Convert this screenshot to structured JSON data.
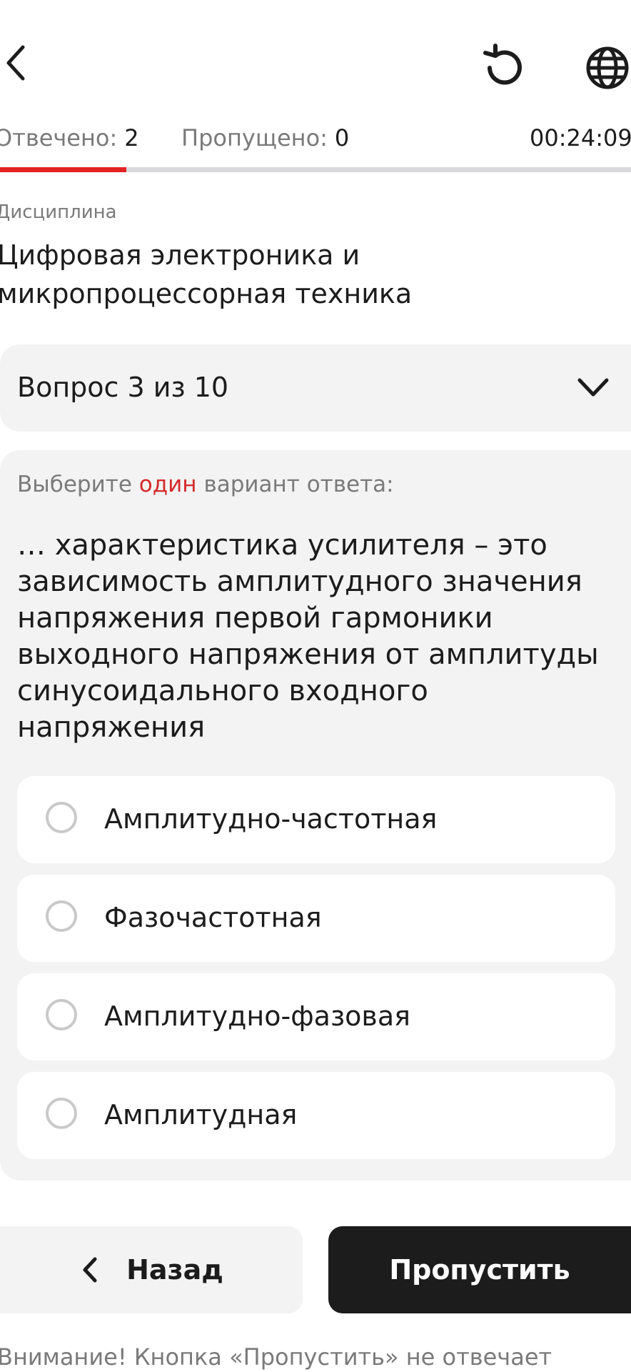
{
  "header": {
    "icons": {
      "back": "chevron-left-icon",
      "reset": "reset-icon",
      "language": "globe-icon"
    }
  },
  "stats": {
    "answered_label": "Отвечено:",
    "answered_value": "2",
    "skipped_label": "Пропущено:",
    "skipped_value": "0",
    "timer": "00:24:09"
  },
  "progress": {
    "fraction": 0.2,
    "fill_color": "#e32222",
    "track_color": "#d9d9dc"
  },
  "discipline": {
    "label": "Дисциплина",
    "title": "Цифровая электроника и микропроцессорная техника"
  },
  "question_header": {
    "label": "Вопрос 3 из 10"
  },
  "question": {
    "instruction_prefix": "Выберите",
    "instruction_accent": "один",
    "instruction_suffix": "вариант ответа:",
    "text": "… характеристика усилителя – это зависимость амплитудного значения напряжения первой гармоники выходного напряжения от амплитуды синусоидального входного напряжения",
    "options": [
      {
        "label": "Амплитудно-частотная"
      },
      {
        "label": "Фазочастотная"
      },
      {
        "label": "Амплитудно-фазовая"
      },
      {
        "label": "Амплитудная"
      }
    ]
  },
  "buttons": {
    "back_label": "Назад",
    "skip_label": "Пропустить"
  },
  "notice": "Внимание! Кнопка «Пропустить» не отвечает",
  "colors": {
    "accent": "#d42a2a",
    "dark": "#1c1c1c",
    "muted": "#7a7a7a",
    "card_bg": "#f3f3f3"
  }
}
